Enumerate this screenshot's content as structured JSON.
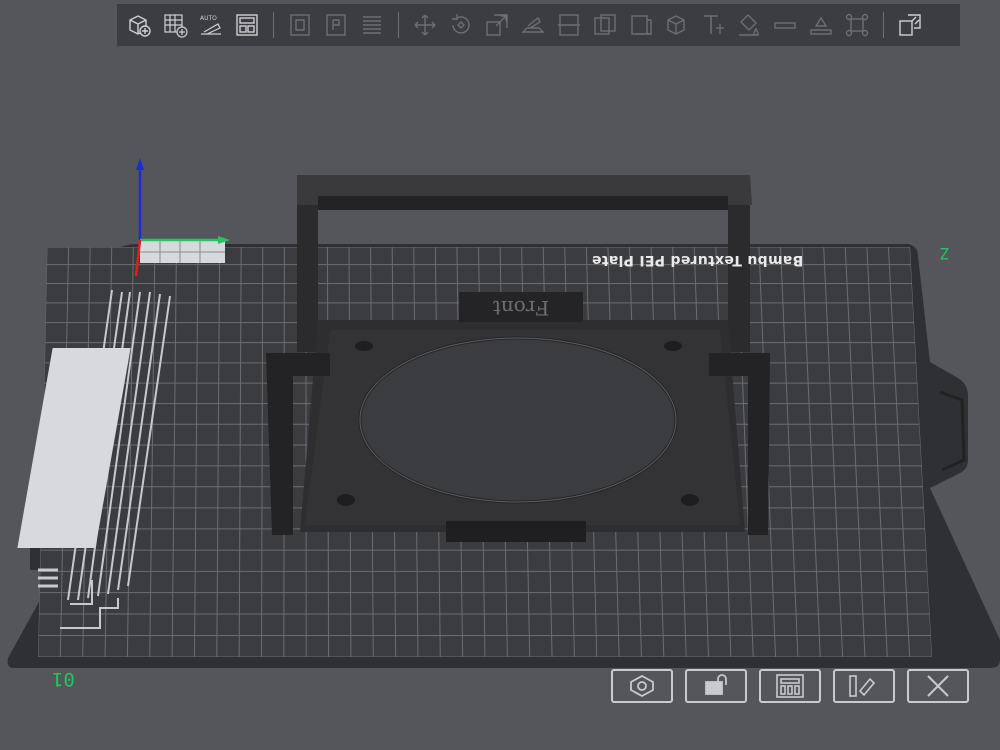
{
  "toolbar": {
    "group1": [
      {
        "name": "add-object-icon"
      },
      {
        "name": "add-plate-icon"
      },
      {
        "name": "auto-orient-icon",
        "text": "AUTO"
      },
      {
        "name": "arrange-icon"
      }
    ],
    "group2": [
      {
        "name": "split-objects-icon"
      },
      {
        "name": "split-parts-icon"
      },
      {
        "name": "variable-layer-icon"
      }
    ],
    "group3": [
      {
        "name": "move-icon"
      },
      {
        "name": "rotate-icon"
      },
      {
        "name": "scale-icon"
      },
      {
        "name": "lay-on-face-icon"
      },
      {
        "name": "cut-icon"
      },
      {
        "name": "mesh-boolean-icon"
      },
      {
        "name": "support-paint-icon"
      },
      {
        "name": "seam-paint-icon"
      },
      {
        "name": "text-icon"
      },
      {
        "name": "color-paint-icon"
      },
      {
        "name": "measure-icon"
      },
      {
        "name": "assembly-icon"
      },
      {
        "name": "brim-ears-icon"
      }
    ],
    "group4": [
      {
        "name": "assembly-view-icon"
      }
    ]
  },
  "plate": {
    "label": "Bambu Textured PEI Plate",
    "number": "01",
    "corner_mark": "Z"
  },
  "model": {
    "engraved_text": "Front"
  },
  "bottom_bar": [
    {
      "name": "plate-settings-icon"
    },
    {
      "name": "lock-plate-icon"
    },
    {
      "name": "arrange-plate-icon"
    },
    {
      "name": "auto-orient-plate-icon"
    },
    {
      "name": "delete-plate-icon"
    }
  ],
  "colors": {
    "background": "#55565b",
    "plate": "#3b3c40",
    "grid": "#6c6d72",
    "model": "#2b2b2d",
    "axis_x": "#e11d1d",
    "axis_y": "#22c55e",
    "axis_z": "#1d2bd6"
  }
}
